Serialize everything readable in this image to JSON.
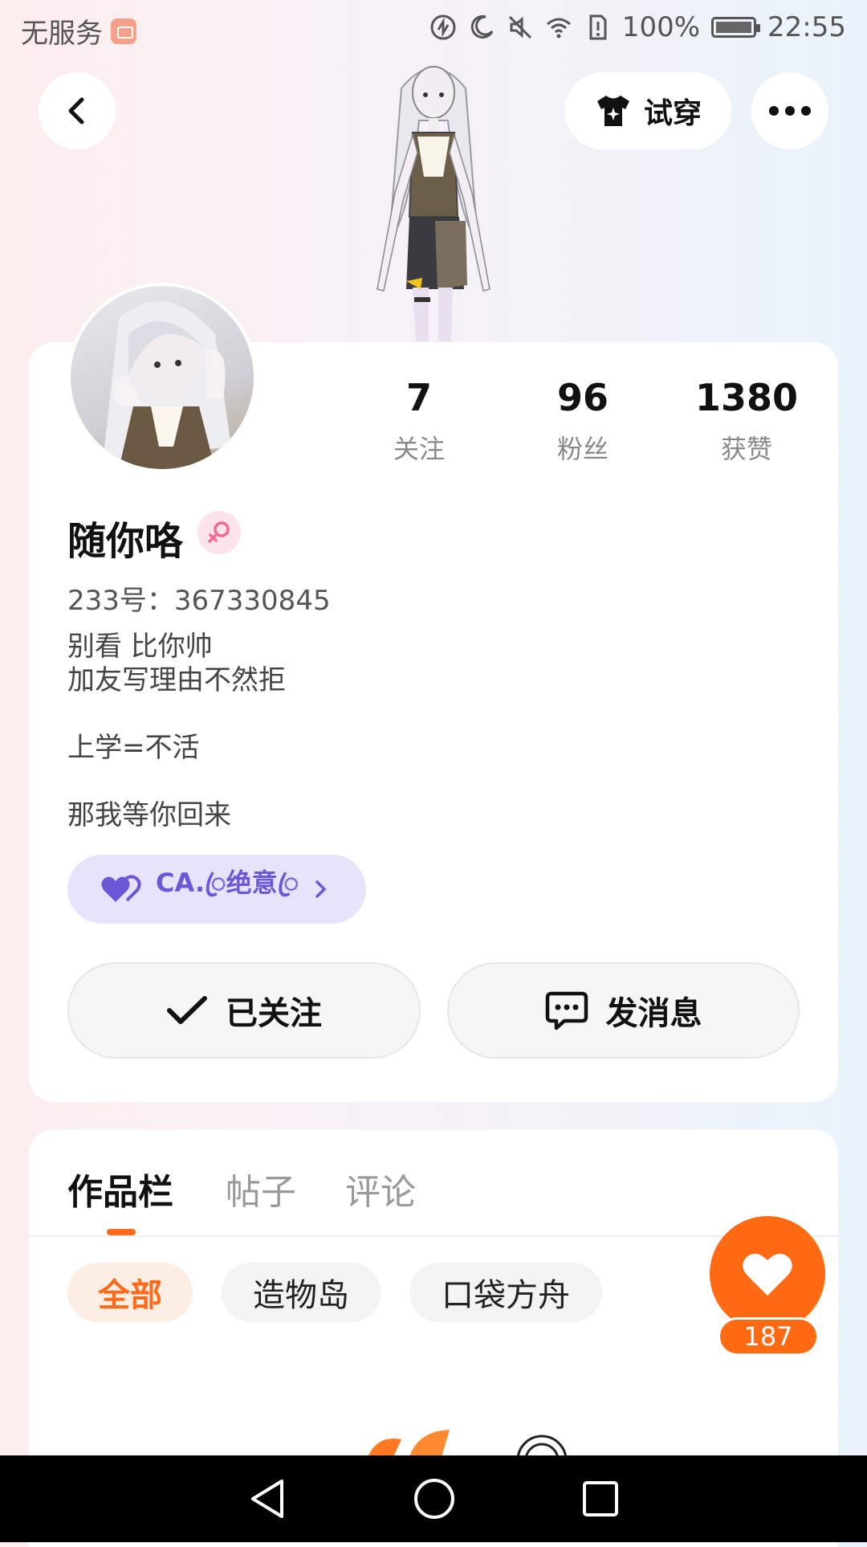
{
  "status_bar": {
    "carrier": "无服务",
    "battery": "100%",
    "time": "22:55"
  },
  "header": {
    "back_icon": "chevron-left-icon",
    "tryon_label": "试穿",
    "more_icon": "more-dots-icon"
  },
  "profile": {
    "stats": [
      {
        "value": "7",
        "label": "关注"
      },
      {
        "value": "96",
        "label": "粉丝"
      },
      {
        "value": "1380",
        "label": "获赞"
      }
    ],
    "username": "随你咯",
    "gender": "female",
    "uid": "233号：367330845",
    "bio": "别看 比你帅\n加友写理由不然拒\n\n上学=不活\n\n那我等你回来",
    "guild_name": "CA.ꦿ绝意ꦿ",
    "follow_label": "已关注",
    "message_label": "发消息",
    "colors": {
      "accent": "#ff6a12",
      "guild": "#6a58d6"
    }
  },
  "works": {
    "tabs": [
      "作品栏",
      "帖子",
      "评论"
    ],
    "active_tab": 0,
    "filters": [
      "全部",
      "造物岛",
      "口袋方舟"
    ],
    "active_filter": 0,
    "like_count": "187"
  }
}
